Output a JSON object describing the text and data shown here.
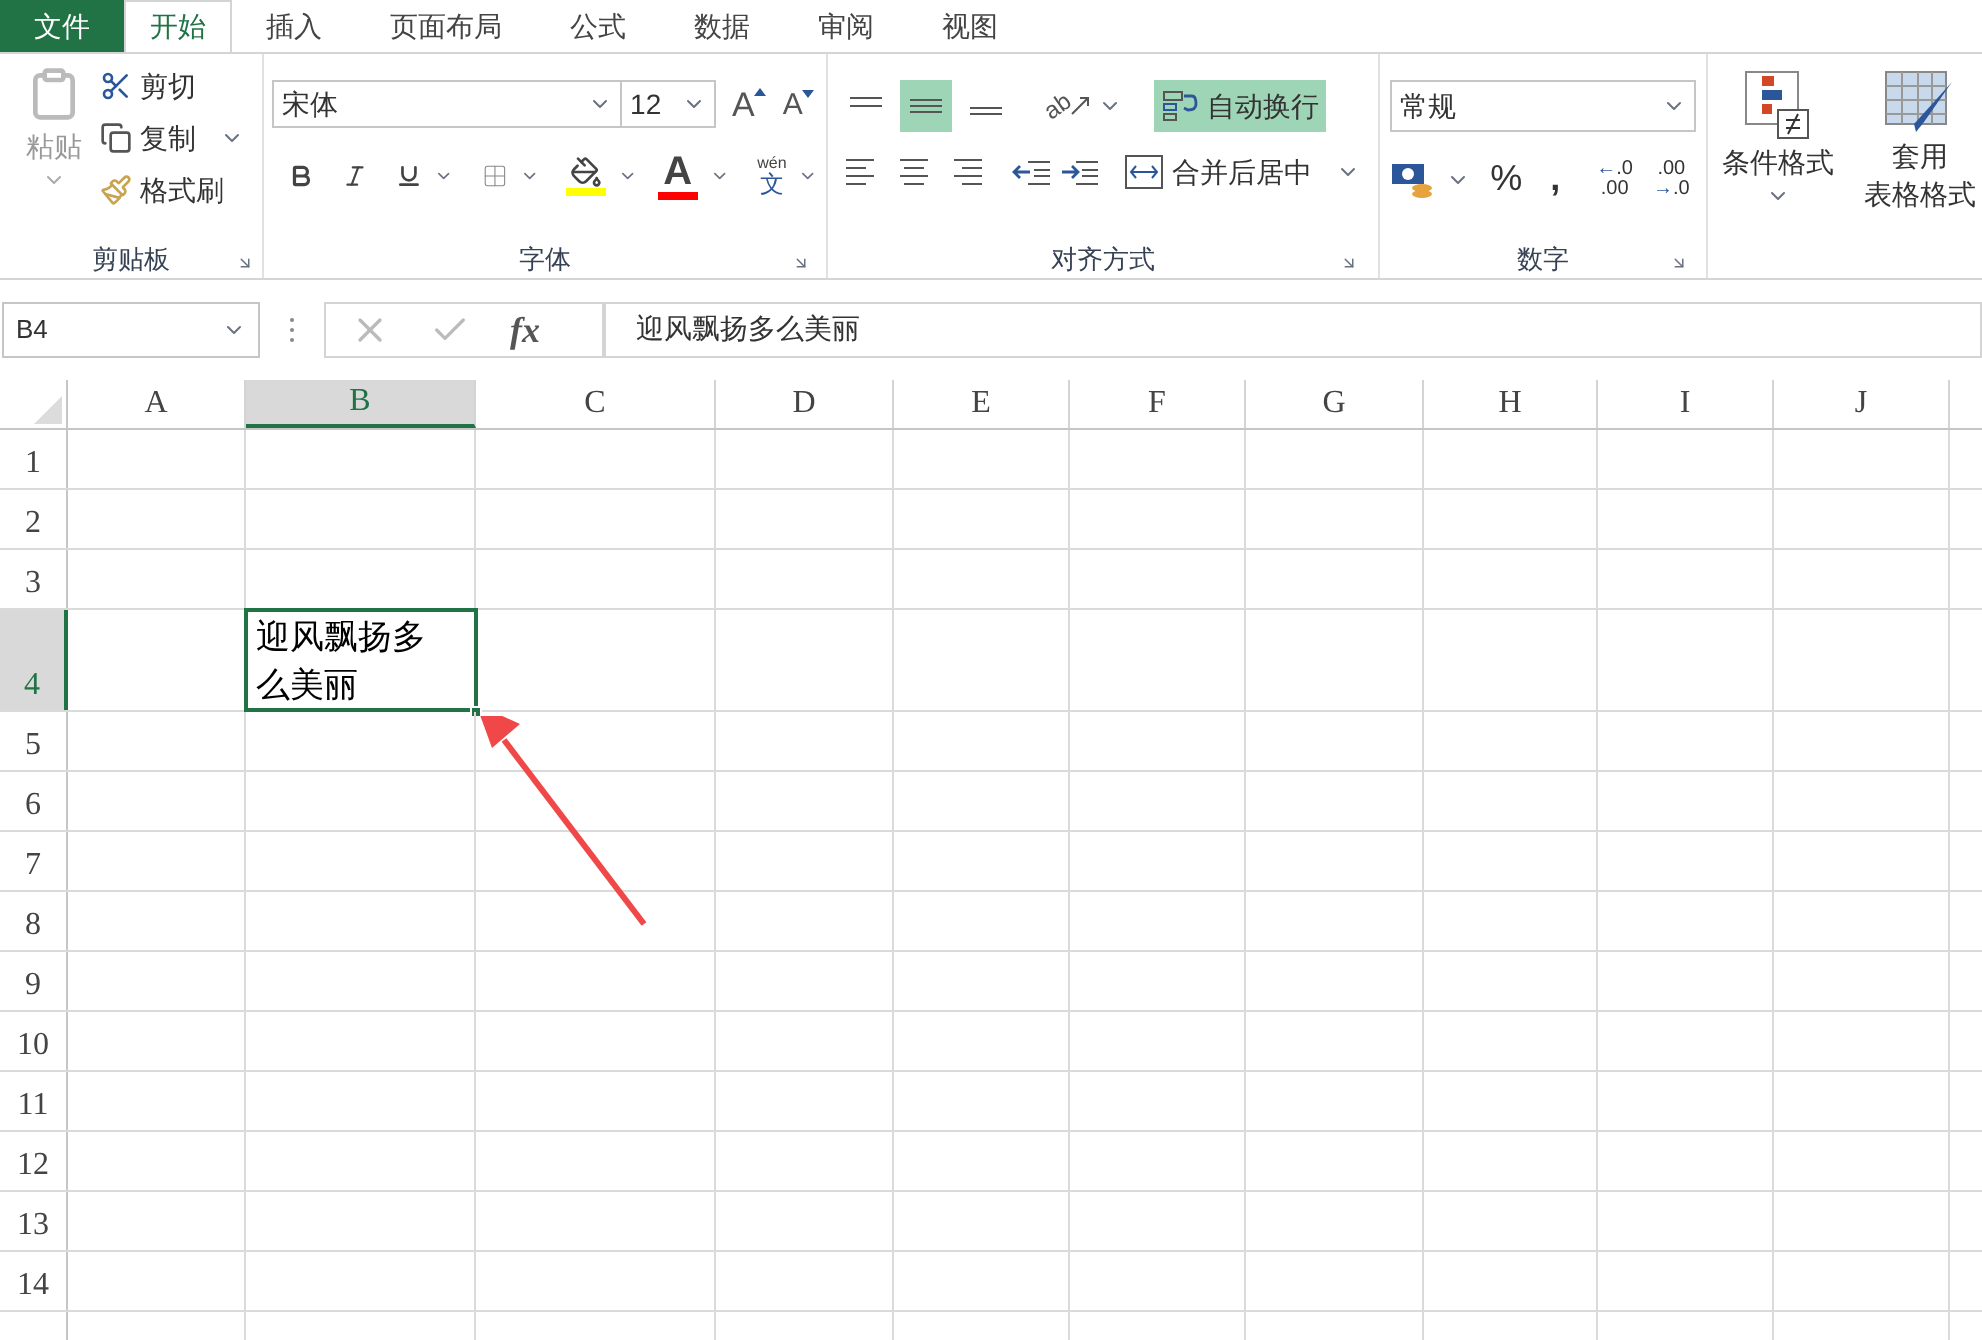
{
  "tabs": [
    {
      "label": "文件",
      "kind": "file",
      "selected": false
    },
    {
      "label": "开始",
      "kind": "tab",
      "selected": true
    },
    {
      "label": "插入",
      "kind": "tab",
      "selected": false
    },
    {
      "label": "页面布局",
      "kind": "tab",
      "selected": false
    },
    {
      "label": "公式",
      "kind": "tab",
      "selected": false
    },
    {
      "label": "数据",
      "kind": "tab",
      "selected": false
    },
    {
      "label": "审阅",
      "kind": "tab",
      "selected": false
    },
    {
      "label": "视图",
      "kind": "tab",
      "selected": false
    }
  ],
  "clipboard": {
    "paste": "粘贴",
    "cut": "剪切",
    "copy": "复制",
    "format_painter": "格式刷",
    "label": "剪贴板"
  },
  "font": {
    "name": "宋体",
    "size": "12",
    "label": "字体",
    "grow": "A",
    "shrink": "A",
    "color_glyph": "A",
    "phonetic": [
      "wén",
      "文"
    ]
  },
  "alignment": {
    "vertical": [
      {
        "kind": "top",
        "selected": false
      },
      {
        "kind": "middle",
        "selected": true
      },
      {
        "kind": "bottom",
        "selected": false
      }
    ],
    "horizontal": [
      {
        "kind": "left",
        "selected": false
      },
      {
        "kind": "center",
        "selected": false
      },
      {
        "kind": "right",
        "selected": false
      }
    ],
    "orientation": "ab",
    "wrap_text": {
      "label": "自动换行",
      "on": true
    },
    "merge": "合并后居中",
    "label": "对齐方式"
  },
  "number": {
    "format": "常规",
    "percent": "%",
    "comma": ",",
    "increase_decimal": [
      "←",
      ".0",
      ".00"
    ],
    "decrease_decimal": [
      ".00",
      "→",
      ".0"
    ],
    "label": "数字"
  },
  "styles": {
    "conditional": "条件格式",
    "table": [
      "套用",
      "表格格式"
    ]
  },
  "formula_bar": {
    "name_box": "B4",
    "fx": "fx",
    "formula": "迎风飘扬多么美丽"
  },
  "columns": [
    {
      "label": "A",
      "selected": false
    },
    {
      "label": "B",
      "selected": true
    },
    {
      "label": "C",
      "selected": false
    },
    {
      "label": "D",
      "selected": false
    },
    {
      "label": "E",
      "selected": false
    },
    {
      "label": "F",
      "selected": false
    },
    {
      "label": "G",
      "selected": false
    },
    {
      "label": "H",
      "selected": false
    },
    {
      "label": "I",
      "selected": false
    },
    {
      "label": "J",
      "selected": false
    }
  ],
  "rows": [
    {
      "label": "1",
      "selected": false
    },
    {
      "label": "2",
      "selected": false
    },
    {
      "label": "3",
      "selected": false
    },
    {
      "label": "4",
      "selected": true,
      "cells": [
        null,
        {
          "text": "迎风飘扬多么美丽",
          "selected": true
        }
      ]
    },
    {
      "label": "5",
      "selected": false
    },
    {
      "label": "6",
      "selected": false
    },
    {
      "label": "7",
      "selected": false
    },
    {
      "label": "8",
      "selected": false
    },
    {
      "label": "9",
      "selected": false
    },
    {
      "label": "10",
      "selected": false
    },
    {
      "label": "11",
      "selected": false
    },
    {
      "label": "12",
      "selected": false
    },
    {
      "label": "13",
      "selected": false
    },
    {
      "label": "14",
      "selected": false
    }
  ]
}
